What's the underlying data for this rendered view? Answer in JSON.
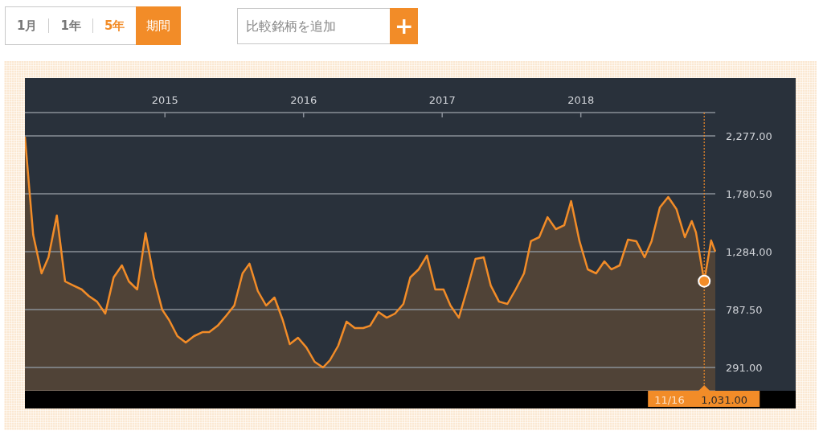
{
  "period_tabs": [
    {
      "label": "1月",
      "selected": false
    },
    {
      "label": "1年",
      "selected": false
    },
    {
      "label": "5年",
      "selected": true
    }
  ],
  "period_button": {
    "label": "期間"
  },
  "compare": {
    "placeholder": "比較銘柄を追加",
    "add_button": "+"
  },
  "chart": {
    "chart_data": {
      "type": "area",
      "x": [
        2013.99,
        2014.05,
        2014.11,
        2014.16,
        2014.22,
        2014.28,
        2014.34,
        2014.4,
        2014.45,
        2014.51,
        2014.57,
        2014.63,
        2014.69,
        2014.74,
        2014.8,
        2014.86,
        2014.92,
        2014.98,
        2015.03,
        2015.09,
        2015.15,
        2015.21,
        2015.27,
        2015.32,
        2015.38,
        2015.44,
        2015.5,
        2015.56,
        2015.61,
        2015.67,
        2015.73,
        2015.79,
        2015.85,
        2015.9,
        2015.96,
        2016.02,
        2016.08,
        2016.14,
        2016.19,
        2016.25,
        2016.31,
        2016.37,
        2016.43,
        2016.48,
        2016.54,
        2016.6,
        2016.66,
        2016.72,
        2016.77,
        2016.83,
        2016.89,
        2016.95,
        2017.01,
        2017.06,
        2017.12,
        2017.18,
        2017.24,
        2017.3,
        2017.35,
        2017.41,
        2017.47,
        2017.53,
        2017.59,
        2017.64,
        2017.7,
        2017.76,
        2017.82,
        2017.88,
        2017.93,
        2017.99,
        2018.05,
        2018.11,
        2018.17,
        2018.22,
        2018.28,
        2018.34,
        2018.4,
        2018.46,
        2018.51,
        2018.57,
        2018.63,
        2018.69,
        2018.75,
        2018.8,
        2018.83,
        2018.89,
        2018.94,
        2018.97
      ],
      "series": [
        {
          "color": "#f28c28",
          "values": [
            2270,
            1429,
            1098,
            1236,
            1594,
            1029,
            994,
            960,
            905,
            856,
            753,
            1063,
            1167,
            1029,
            960,
            1443,
            1063,
            787,
            698,
            560,
            505,
            560,
            594,
            594,
            649,
            732,
            822,
            1098,
            1181,
            946,
            822,
            891,
            698,
            491,
            546,
            463,
            339,
            291,
            353,
            477,
            684,
            629,
            629,
            649,
            767,
            718,
            753,
            836,
            1063,
            1132,
            1250,
            960,
            960,
            822,
            718,
            960,
            1222,
            1236,
            994,
            856,
            836,
            960,
            1098,
            1374,
            1408,
            1580,
            1477,
            1511,
            1718,
            1374,
            1132,
            1098,
            1201,
            1132,
            1167,
            1387,
            1374,
            1236,
            1374,
            1663,
            1753,
            1649,
            1408,
            1546,
            1450,
            1031,
            1380,
            1284
          ]
        }
      ],
      "xlim": [
        2013.99,
        2018.97
      ],
      "ylim": [
        91,
        2477
      ],
      "grid": true,
      "ref_lines": [
        {
          "axis": "x",
          "value": 2018.89,
          "color": "#f28c28"
        }
      ],
      "xticks": [
        {
          "value": 2015,
          "label": "2015"
        },
        {
          "value": 2016,
          "label": "2016"
        },
        {
          "value": 2017,
          "label": "2017"
        },
        {
          "value": 2018,
          "label": "2018"
        }
      ],
      "yticks": [
        {
          "value": 291,
          "label": "291.00"
        },
        {
          "value": 787.5,
          "label": "787.50"
        },
        {
          "value": 1284,
          "label": "1,284.00"
        },
        {
          "value": 1780.5,
          "label": "1,780.50"
        },
        {
          "value": 2277,
          "label": "2,277.00"
        }
      ],
      "annotations": [
        "1,031.00"
      ]
    },
    "cursor_date": "11/16"
  }
}
